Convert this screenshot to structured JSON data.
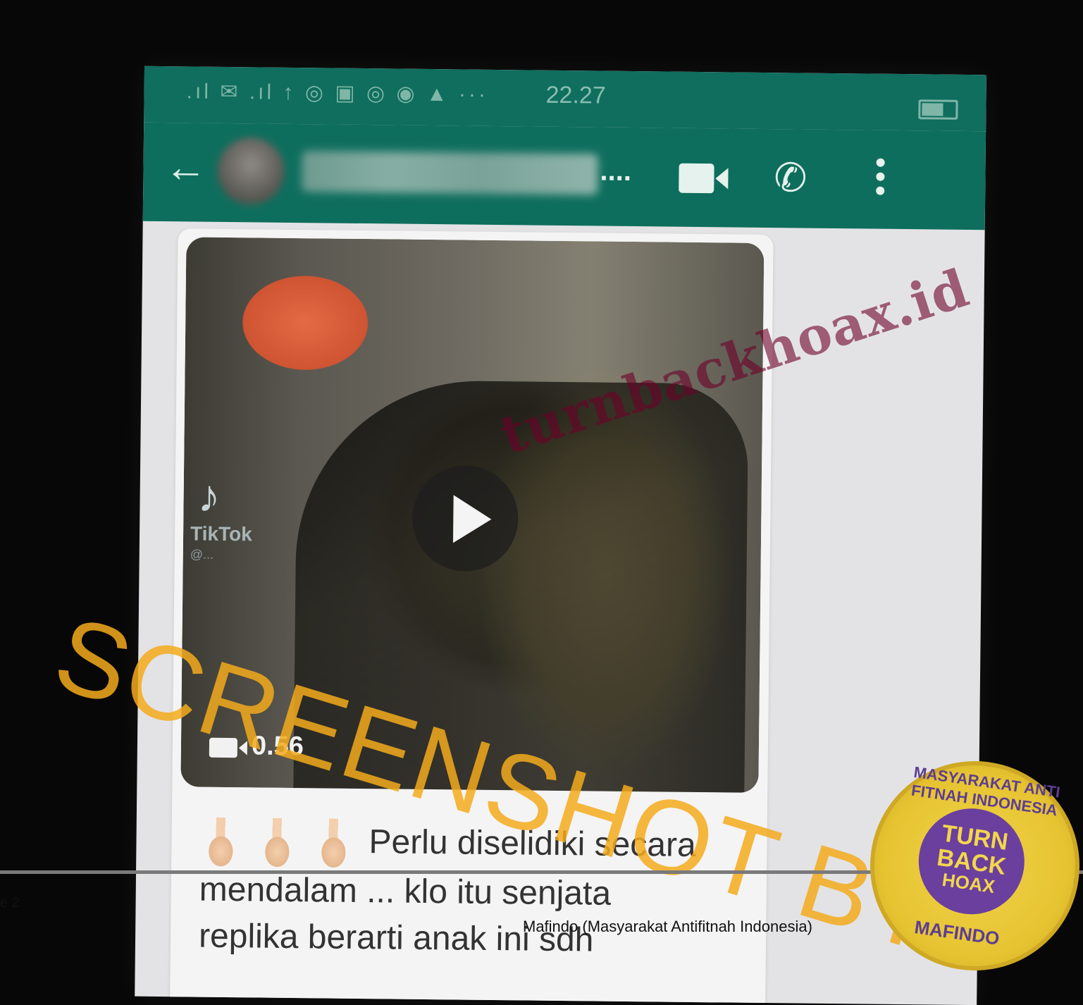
{
  "status_bar": {
    "time": "22.27",
    "icons_text": ".ıl ✉ .ıl ↑ ◎ ▣ ◎ ◉ ▲ ···"
  },
  "chat_header": {
    "back_icon": "arrow-left",
    "contact_ellipsis": "....",
    "video_call_icon": "video-camera",
    "voice_call_icon": "phone",
    "menu_icon": "more-vertical"
  },
  "message": {
    "video": {
      "tiktok_label": "TikTok",
      "tiktok_handle": "@...",
      "duration": "0.56"
    },
    "caption_line1": "Perlu diselidiki secara",
    "caption_line2": "mendalam ... klo itu senjata",
    "caption_line3": "replika berarti anak ini sdh"
  },
  "watermarks": {
    "site": "turnbackhoax.id",
    "screenshot_by": "SCREENSHOT BY"
  },
  "badge": {
    "ring_text": "MASYARAKAT ANTI FITNAH INDONESIA",
    "inner_l1": "TURN",
    "inner_l2": "BACK",
    "inner_l3": "HOAX",
    "bottom": "MAFINDO"
  },
  "footer": {
    "left_fragment": "e 2",
    "caption": "Mafindo (Masyarakat Antifitnah Indonesia)"
  },
  "colors": {
    "whatsapp_green": "#0e6e5d",
    "watermark_orange": "#f3aa1c",
    "badge_yellow": "#e6c331",
    "badge_purple": "#6b3f9e"
  }
}
